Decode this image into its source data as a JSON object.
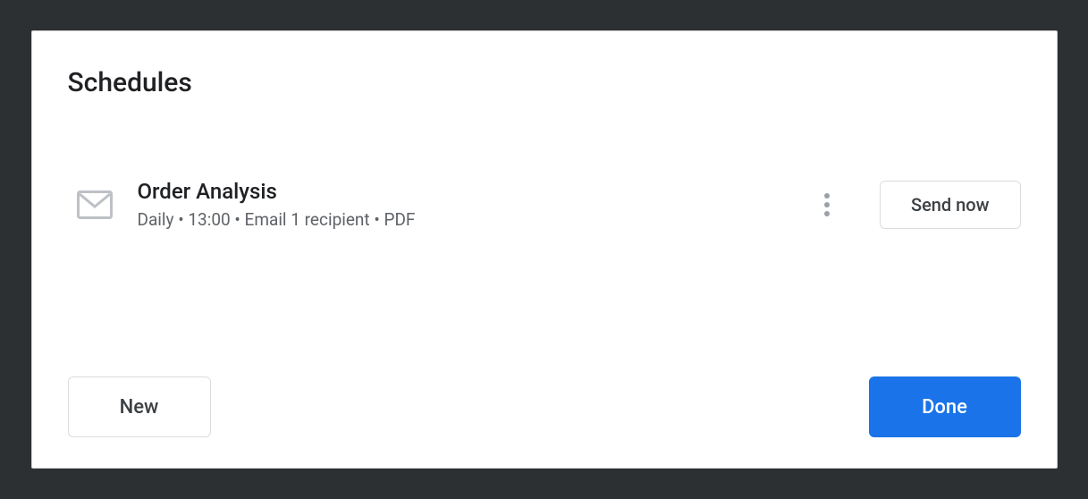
{
  "dialog": {
    "title": "Schedules"
  },
  "schedule": {
    "name": "Order Analysis",
    "detail": "Daily • 13:00 • Email 1 recipient • PDF",
    "send_now_label": "Send now"
  },
  "footer": {
    "new_label": "New",
    "done_label": "Done"
  }
}
